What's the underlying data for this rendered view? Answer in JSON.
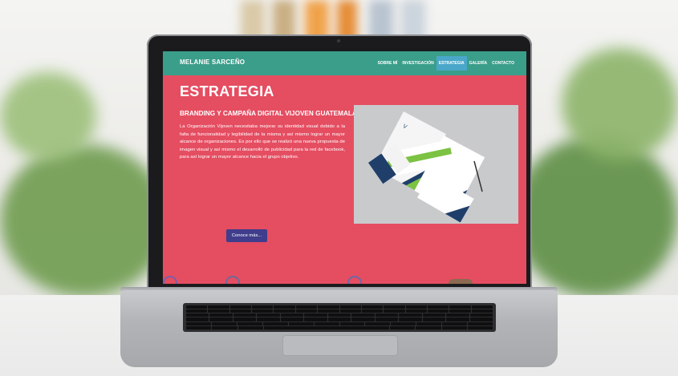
{
  "site": {
    "brand": "MELANIE SARCEÑO",
    "nav": [
      {
        "label": "SOBRE MÍ",
        "active": false
      },
      {
        "label": "INVESTIGACIÓN",
        "active": false
      },
      {
        "label": "ESTRATEGIA",
        "active": true
      },
      {
        "label": "GALERÍA",
        "active": false
      },
      {
        "label": "CONTACTO",
        "active": false
      }
    ],
    "section_title": "ESTRATEGIA",
    "project_title": "BRANDING Y CAMPAÑA DIGITAL VIJOVEN GUATEMALA",
    "description": "La Organización Vijoven necesitaba mejorar su identidad visual debido a la falta de funcionalidad y legibilidad de la misma y así mismo lograr un mayor alcance de organizaciones. Es por ello que se realizó una nueva propuesta de imagen visual y así mismo el desarrolló de publicidad para la red de facebook, para así lograr un mayor alcance hacia el grupo objetivo.",
    "cta_label": "Conoce más..."
  },
  "colors": {
    "nav_bg": "#3a9e8a",
    "page_bg": "#e54d61",
    "active_nav": "#4aa7c9",
    "button_bg": "#3f3d8c"
  },
  "icons": [
    "stationery-mockup-image",
    "laptop-keyboard",
    "trackpad"
  ]
}
